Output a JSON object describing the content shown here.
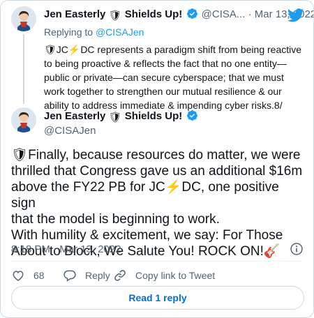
{
  "parent": {
    "author_name": "Jen Easterly",
    "shield_emoji": "🛡",
    "author_suffix": "Shields Up!",
    "handle": "@CISA...",
    "separator": "·",
    "date": "Mar 13, 2022",
    "replying_to_label": "Replying to",
    "replying_to_handle": "@CISAJen",
    "text_lines": [
      "🛡JC⚡DC represents a paradigm shift from being reactive",
      "to being proactive & reflects the fact that no one entity—",
      "public or private—can secure cyberspace; that we must",
      "work together to strengthen our mutual resilience & our",
      "ability to address immediate & impending cyber risks.8/"
    ]
  },
  "tweet": {
    "author_name": "Jen Easterly",
    "shield_emoji": "🛡",
    "author_suffix": "Shields Up!",
    "handle": "@CISAJen",
    "text_lines": [
      "🛡Finally, because resources do matter, we were",
      "thrilled that Congress gave us an additional $16m",
      "above the FY22 PB for JC⚡DC, one positive sign",
      "that the model is beginning to work.",
      "With humility & excitement, we say: For Those",
      "About to Block, We Salute You! ROCK ON!🎸"
    ],
    "timestamp": "8:18 PM · Mar 13, 2022"
  },
  "actions": {
    "like_count": "68",
    "reply_label": "Reply",
    "copy_link_label": "Copy link to Tweet"
  },
  "read_replies_label": "Read 1 reply",
  "colors": {
    "twitter_blue": "#1d9bf0",
    "verified_blue": "#1d9bf0",
    "text": "#0f1419",
    "muted": "#536471",
    "border": "#cfd9de",
    "button_text": "#006fd6"
  },
  "icons": [
    "twitter-logo-icon",
    "verified-badge-icon",
    "info-icon",
    "heart-icon",
    "reply-icon",
    "link-icon"
  ]
}
